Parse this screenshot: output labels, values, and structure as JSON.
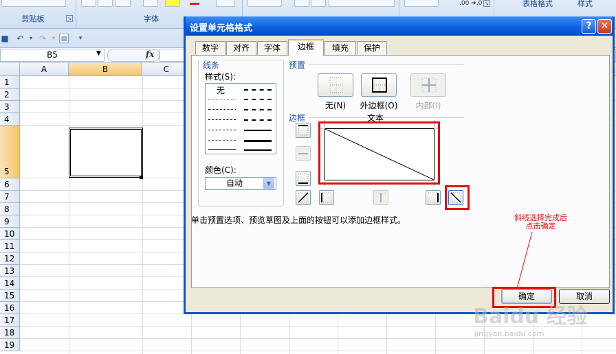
{
  "ribbon": {
    "group_clipboard": "剪贴板",
    "group_font": "字体",
    "right_label_1": "表格格式",
    "right_label_2": "样式",
    "number_buttons": ".00 ➔.0"
  },
  "formula_bar": {
    "name_box": "B5",
    "fx": "fx"
  },
  "sheet": {
    "columns": [
      "A",
      "B",
      "C"
    ],
    "selected_column": "B",
    "rows": [
      "1",
      "2",
      "3",
      "4",
      "5",
      "6",
      "7",
      "8",
      "9",
      "10",
      "11",
      "12",
      "13",
      "14",
      "15",
      "16",
      "17",
      "18",
      "19"
    ],
    "selected_row": "5"
  },
  "dialog": {
    "title": "设置单元格格式",
    "help_label": "?",
    "close_label": "✕",
    "tabs": [
      {
        "label": "数字",
        "active": false
      },
      {
        "label": "对齐",
        "active": false
      },
      {
        "label": "字体",
        "active": false
      },
      {
        "label": "边框",
        "active": true
      },
      {
        "label": "填充",
        "active": false
      },
      {
        "label": "保护",
        "active": false
      }
    ],
    "line_section": "线条",
    "style_label": "样式(S):",
    "style_none": "无",
    "color_label": "颜色(C):",
    "color_value": "自动",
    "preset_section": "预置",
    "presets": [
      "无(N)",
      "外边框(O)",
      "内部(I)"
    ],
    "border_section": "边框",
    "preview_text": "文本",
    "hint": "单击预置选项、预览草图及上面的按钮可以添加边框样式。",
    "ok_label": "确定",
    "cancel_label": "取消"
  },
  "annotation": {
    "line1": "斜线选择完成后",
    "line2": "点击确定",
    "color": "#e01010"
  },
  "watermark": {
    "text": "Baidu 经验",
    "sub": "jingyan.baidu.com"
  }
}
